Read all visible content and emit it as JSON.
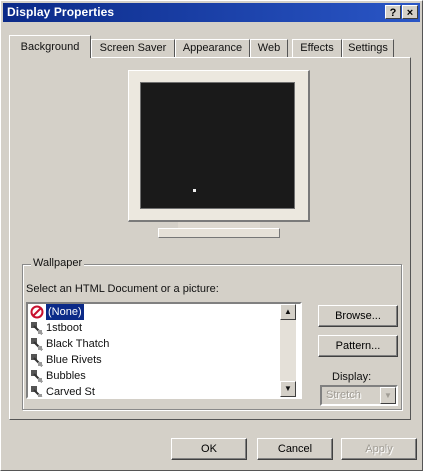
{
  "window": {
    "title": "Display Properties",
    "help_button": "?",
    "close_button": "×"
  },
  "tabs": [
    {
      "label": "Background",
      "active": true
    },
    {
      "label": "Screen Saver",
      "active": false
    },
    {
      "label": "Appearance",
      "active": false
    },
    {
      "label": "Web",
      "active": false
    },
    {
      "label": "Effects",
      "active": false
    },
    {
      "label": "Settings",
      "active": false
    }
  ],
  "wallpaper": {
    "group_label": "Wallpaper",
    "select_label": "Select an HTML Document or a picture:",
    "items": [
      {
        "label": "(None)",
        "icon": "none-icon",
        "selected": true
      },
      {
        "label": "1stboot",
        "icon": "wallpaper-file-icon",
        "selected": false
      },
      {
        "label": "Black Thatch",
        "icon": "wallpaper-file-icon",
        "selected": false
      },
      {
        "label": "Blue Rivets",
        "icon": "wallpaper-file-icon",
        "selected": false
      },
      {
        "label": "Bubbles",
        "icon": "wallpaper-file-icon",
        "selected": false
      },
      {
        "label": "Carved St",
        "icon": "wallpaper-file-icon",
        "selected": false
      }
    ],
    "browse_label": "Browse...",
    "pattern_label": "Pattern...",
    "display_label": "Display:",
    "display_value": "Stretch"
  },
  "footer": {
    "ok_label": "OK",
    "cancel_label": "Cancel",
    "apply_label": "Apply"
  },
  "colors": {
    "title_bar": "#0b2a88",
    "selection": "#0b2a88",
    "face": "#d4d0c8",
    "screen": "#1a1a1a"
  }
}
